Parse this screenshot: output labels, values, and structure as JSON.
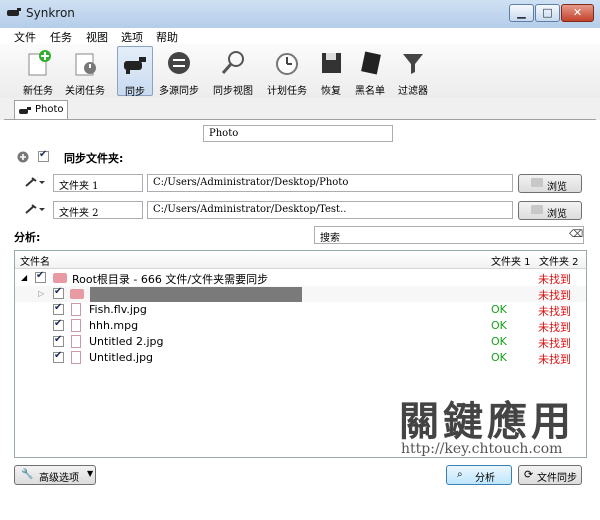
{
  "window": {
    "title": "Synkron"
  },
  "menu": [
    "文件",
    "任务",
    "视图",
    "选项",
    "帮助"
  ],
  "toolbar": [
    {
      "label": "新任务",
      "icon": "new-task-icon"
    },
    {
      "label": "关闭任务",
      "icon": "close-task-icon"
    },
    {
      "label": "同步",
      "icon": "sync-icon",
      "active": true
    },
    {
      "label": "多源同步",
      "icon": "multisync-icon"
    },
    {
      "label": "同步视图",
      "icon": "magnifier-icon"
    },
    {
      "label": "计划任务",
      "icon": "scheduler-icon"
    },
    {
      "label": "恢复",
      "icon": "restore-icon"
    },
    {
      "label": "黑名单",
      "icon": "blacklist-icon"
    },
    {
      "label": "过滤器",
      "icon": "filter-icon"
    }
  ],
  "tab": {
    "label": "Photo"
  },
  "sync": {
    "task_name": "Photo",
    "sync_folders_label": "同步文件夹:",
    "folders": [
      {
        "name": "文件夹 1",
        "path": "C:/Users/Administrator/Desktop/Photo",
        "browse": "浏览"
      },
      {
        "name": "文件夹 2",
        "path": "C:/Users/Administrator/Desktop/Test..",
        "browse": "浏览"
      }
    ],
    "analyse_label": "分析:",
    "search_placeholder": "搜索"
  },
  "tree": {
    "headers": [
      "文件名",
      "文件夹 1",
      "文件夹 2"
    ],
    "root": {
      "label": "Root根目录 - 666 文件/文件夹需要同步",
      "col2": "未找到"
    },
    "subfolder": {
      "col2": "未找到"
    },
    "files": [
      {
        "name": "Fish.flv.jpg",
        "col1": "OK",
        "col2": "未找到"
      },
      {
        "name": "hhh.mpg",
        "col1": "OK",
        "col2": "未找到"
      },
      {
        "name": "Untitled 2.jpg",
        "col1": "OK",
        "col2": "未找到"
      },
      {
        "name": "Untitled.jpg",
        "col1": "OK",
        "col2": "未找到"
      }
    ]
  },
  "watermark": {
    "text": "關鍵應用",
    "url": "http://key.chtouch.com"
  },
  "bottom": {
    "advanced": "高级选项",
    "analyse": "分析",
    "sync": "文件同步"
  },
  "colors": {
    "ok": "#19a019",
    "not_found": "#dd1111",
    "accent": "#c9daf0"
  }
}
